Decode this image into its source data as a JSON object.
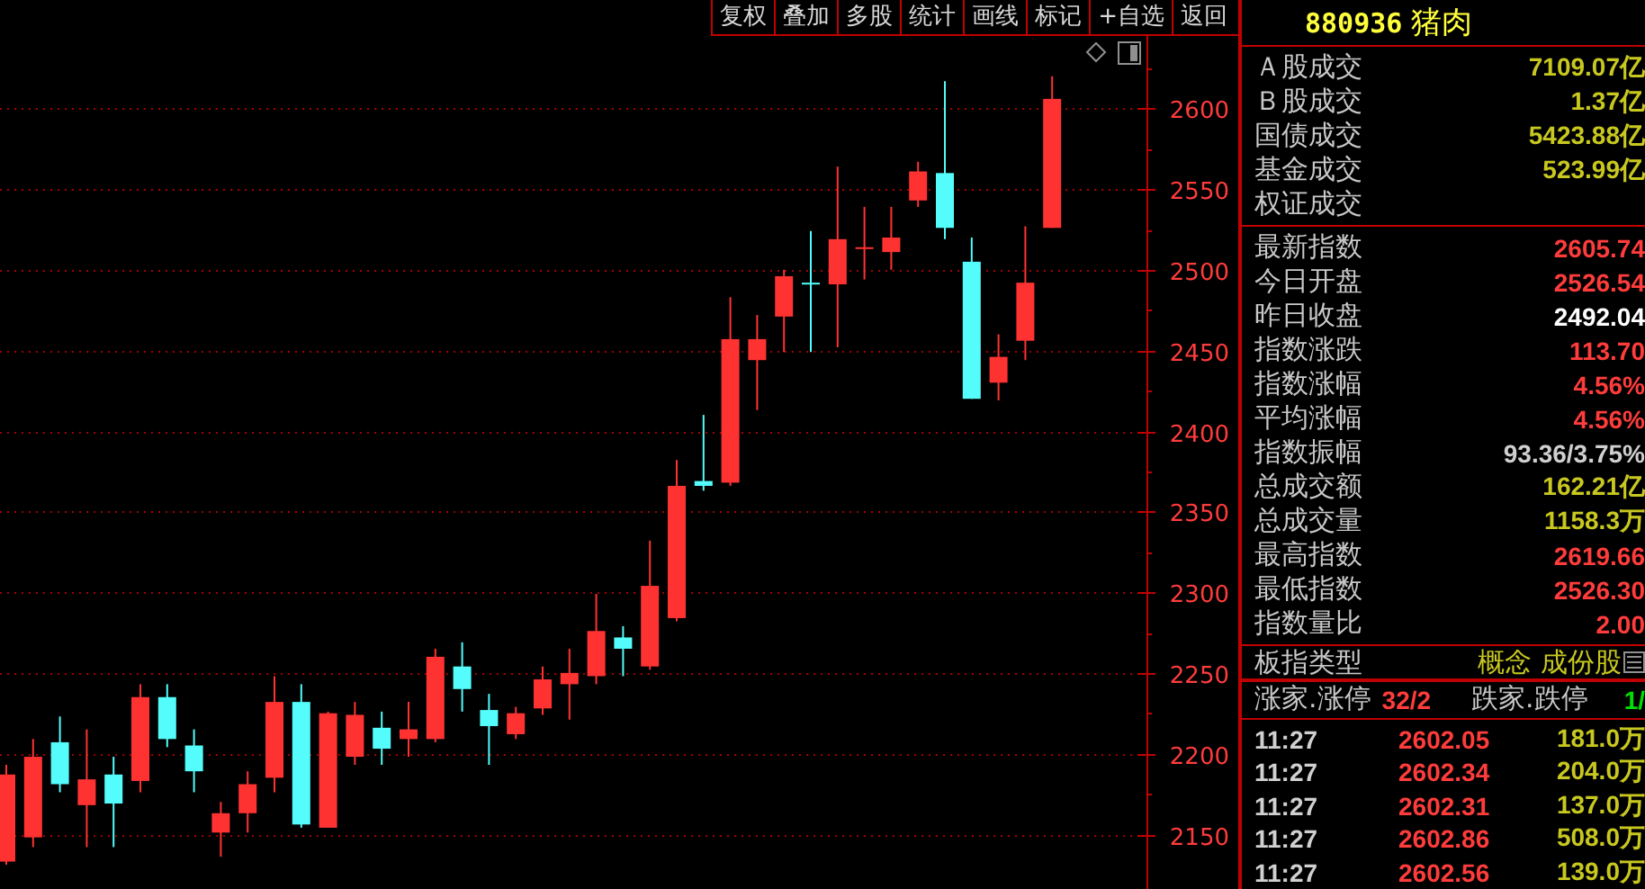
{
  "toolbar": {
    "buttons": [
      "复权",
      "叠加",
      "多股",
      "统计",
      "画线",
      "标记",
      "+自选",
      "返回"
    ]
  },
  "chart": {
    "chart_data": {
      "type": "candlestick",
      "grid": true,
      "ylim": [
        2116,
        2645
      ],
      "yticks": [
        2150,
        2200,
        2250,
        2300,
        2350,
        2400,
        2450,
        2500,
        2550,
        2600
      ],
      "ohlc": [
        [
          2133,
          2193,
          2131,
          2187
        ],
        [
          2148,
          2209,
          2142,
          2198
        ],
        [
          2207,
          2223,
          2176,
          2181
        ],
        [
          2168,
          2215,
          2142,
          2184
        ],
        [
          2187,
          2198,
          2142,
          2169
        ],
        [
          2183,
          2243,
          2176,
          2235
        ],
        [
          2235,
          2243,
          2204,
          2209
        ],
        [
          2205,
          2215,
          2176,
          2189
        ],
        [
          2151,
          2170,
          2136,
          2163
        ],
        [
          2163,
          2189,
          2151,
          2181
        ],
        [
          2185,
          2248,
          2176,
          2232
        ],
        [
          2232,
          2243,
          2154,
          2156
        ],
        [
          2154,
          2226,
          2154,
          2225
        ],
        [
          2198,
          2232,
          2193,
          2224
        ],
        [
          2216,
          2226,
          2193,
          2203
        ],
        [
          2209,
          2232,
          2198,
          2215
        ],
        [
          2209,
          2265,
          2207,
          2260
        ],
        [
          2254,
          2269,
          2226,
          2240
        ],
        [
          2227,
          2237,
          2193,
          2217
        ],
        [
          2212,
          2229,
          2209,
          2225
        ],
        [
          2228,
          2254,
          2224,
          2246
        ],
        [
          2243,
          2265,
          2221,
          2250
        ],
        [
          2248,
          2299,
          2243,
          2276
        ],
        [
          2272,
          2279,
          2248,
          2265
        ],
        [
          2254,
          2332,
          2252,
          2304
        ],
        [
          2284,
          2382,
          2282,
          2366
        ],
        [
          2369,
          2410,
          2363,
          2366
        ],
        [
          2368,
          2483,
          2366,
          2457
        ],
        [
          2444,
          2472,
          2413,
          2457
        ],
        [
          2471,
          2500,
          2449,
          2496
        ],
        [
          2492,
          2524,
          2449,
          2491
        ],
        [
          2491,
          2564,
          2452,
          2519
        ],
        [
          2513,
          2539,
          2494,
          2514
        ],
        [
          2511,
          2539,
          2500,
          2520
        ],
        [
          2543,
          2567,
          2539,
          2561
        ],
        [
          2560,
          2617,
          2519,
          2526
        ],
        [
          2505,
          2520,
          2420,
          2420
        ],
        [
          2430,
          2460,
          2419,
          2446
        ],
        [
          2456,
          2527,
          2444,
          2492
        ],
        [
          2526,
          2620,
          2526,
          2606
        ]
      ]
    }
  },
  "quote": {
    "code": "880936",
    "name": "猪肉",
    "turnover": [
      {
        "label": "Ａ股成交",
        "value": "7109.07亿",
        "color": "#c8c820"
      },
      {
        "label": "Ｂ股成交",
        "value": "1.37亿",
        "color": "#c8c820"
      },
      {
        "label": "国债成交",
        "value": "5423.88亿",
        "color": "#c8c820"
      },
      {
        "label": "基金成交",
        "value": "523.99亿",
        "color": "#c8c820"
      },
      {
        "label": "权证成交"
      }
    ],
    "stats": [
      {
        "label": "最新指数",
        "value": "2605.74",
        "color": "#ff3c3c"
      },
      {
        "label": "今日开盘",
        "value": "2526.54",
        "color": "#ff3c3c"
      },
      {
        "label": "昨日收盘",
        "value": "2492.04",
        "color": "#ffffff"
      },
      {
        "label": "指数涨跌",
        "value": "113.70",
        "color": "#ff3c3c"
      },
      {
        "label": "指数涨幅",
        "value": "4.56%",
        "color": "#ff3c3c"
      },
      {
        "label": "平均涨幅",
        "value": "4.56%",
        "color": "#ff3c3c"
      },
      {
        "label": "指数振幅",
        "value": "93.36/3.75%",
        "color": "#d0d0d0"
      },
      {
        "label": "总成交额",
        "value": "162.21亿",
        "color": "#c8c820"
      },
      {
        "label": "总成交量",
        "value": "1158.3万",
        "color": "#c8c820"
      },
      {
        "label": "最高指数",
        "value": "2619.66",
        "color": "#ff3c3c"
      },
      {
        "label": "最低指数",
        "value": "2526.30",
        "color": "#ff3c3c"
      },
      {
        "label": "指数量比",
        "value": "2.00",
        "color": "#ff3c3c"
      }
    ],
    "sector_type": {
      "label": "板指类型",
      "value": "概念 成份股"
    },
    "breadth": {
      "up_label": "涨家.涨停",
      "up_value": "32/2",
      "down_label": "跌家.跌停",
      "down_value": "1/"
    },
    "ticks": [
      {
        "time": "11:27",
        "price": "2602.05",
        "volume": "181.0万"
      },
      {
        "time": "11:27",
        "price": "2602.34",
        "volume": "204.0万"
      },
      {
        "time": "11:27",
        "price": "2602.31",
        "volume": "137.0万"
      },
      {
        "time": "11:27",
        "price": "2602.86",
        "volume": "508.0万"
      },
      {
        "time": "11:27",
        "price": "2602.56",
        "volume": "139.0万"
      }
    ]
  }
}
